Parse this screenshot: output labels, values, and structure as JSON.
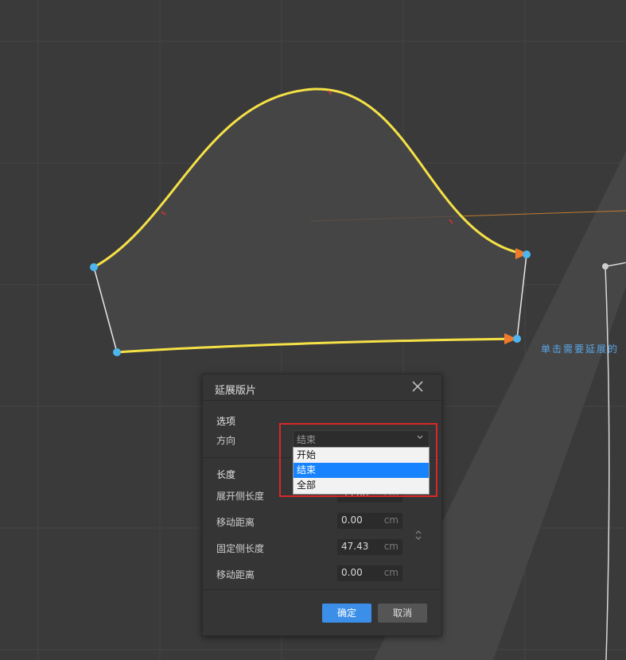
{
  "canvas": {
    "hint_text": "单击需要延展的",
    "colors": {
      "background": "#3a3a3a",
      "piece_fill": "#484848",
      "edge_highlight": "#f5e146",
      "node": "#4db6ee",
      "arrow": "#f07a2a",
      "guide_line": "#c07a30"
    }
  },
  "dialog": {
    "title": "延展版片",
    "close_icon": "close-icon",
    "options_section": "选项",
    "direction_label": "方向",
    "direction_value": "结束",
    "direction_options": [
      "开始",
      "结束",
      "全部"
    ],
    "selected_option_index": 1,
    "length_section": "长度",
    "expand_side_length_label": "展开侧长度",
    "expand_side_length_value": "33.06",
    "move_distance_label_1": "移动距离",
    "move_distance_value_1": "0.00",
    "fixed_side_length_label": "固定侧长度",
    "fixed_side_length_value": "47.43",
    "move_distance_label_2": "移动距离",
    "move_distance_value_2": "0.00",
    "unit": "cm",
    "ok_label": "确定",
    "cancel_label": "取消",
    "accent_color": "#3c8fe8",
    "highlight_color": "#d62828"
  }
}
